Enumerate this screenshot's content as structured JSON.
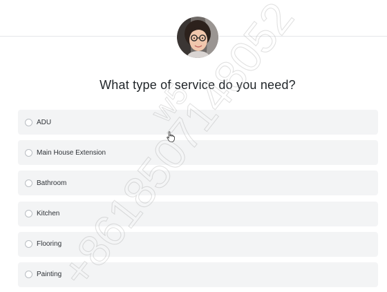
{
  "question": {
    "title": "What type of service do you need?"
  },
  "options": [
    {
      "label": "ADU",
      "selected": false
    },
    {
      "label": "Main House Extension",
      "selected": false
    },
    {
      "label": "Bathroom",
      "selected": false
    },
    {
      "label": "Kitchen",
      "selected": false
    },
    {
      "label": "Flooring",
      "selected": false
    },
    {
      "label": "Painting",
      "selected": false
    }
  ],
  "watermark": {
    "text": "+8618507148052",
    "sub_text": "w5"
  },
  "colors": {
    "option_background": "#f3f4f5",
    "title_text": "#1f2428",
    "radio_border": "#b9bdc2"
  }
}
